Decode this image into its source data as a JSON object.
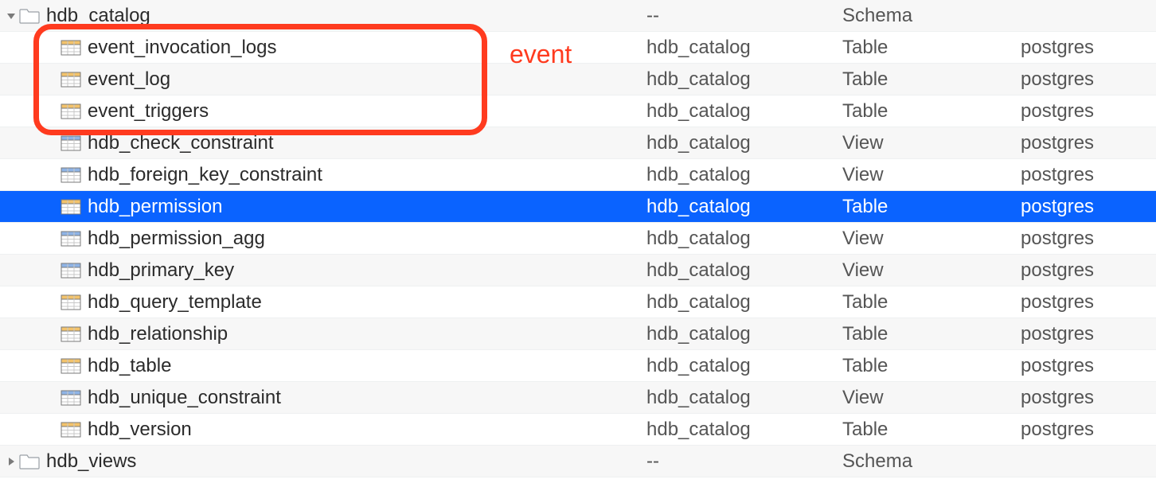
{
  "annotation": {
    "text": "event"
  },
  "rows": [
    {
      "expand": "open",
      "indent": 0,
      "icon": "folder",
      "name": "hdb_catalog",
      "schema": "--",
      "kind": "Schema",
      "owner": "",
      "selected": false,
      "alt": true
    },
    {
      "expand": "none",
      "indent": 1,
      "icon": "table",
      "name": "event_invocation_logs",
      "schema": "hdb_catalog",
      "kind": "Table",
      "owner": "postgres",
      "selected": false,
      "alt": false
    },
    {
      "expand": "none",
      "indent": 1,
      "icon": "table",
      "name": "event_log",
      "schema": "hdb_catalog",
      "kind": "Table",
      "owner": "postgres",
      "selected": false,
      "alt": true
    },
    {
      "expand": "none",
      "indent": 1,
      "icon": "table",
      "name": "event_triggers",
      "schema": "hdb_catalog",
      "kind": "Table",
      "owner": "postgres",
      "selected": false,
      "alt": false
    },
    {
      "expand": "none",
      "indent": 1,
      "icon": "view",
      "name": "hdb_check_constraint",
      "schema": "hdb_catalog",
      "kind": "View",
      "owner": "postgres",
      "selected": false,
      "alt": true
    },
    {
      "expand": "none",
      "indent": 1,
      "icon": "view",
      "name": "hdb_foreign_key_constraint",
      "schema": "hdb_catalog",
      "kind": "View",
      "owner": "postgres",
      "selected": false,
      "alt": false
    },
    {
      "expand": "none",
      "indent": 1,
      "icon": "table",
      "name": "hdb_permission",
      "schema": "hdb_catalog",
      "kind": "Table",
      "owner": "postgres",
      "selected": true,
      "alt": true
    },
    {
      "expand": "none",
      "indent": 1,
      "icon": "view",
      "name": "hdb_permission_agg",
      "schema": "hdb_catalog",
      "kind": "View",
      "owner": "postgres",
      "selected": false,
      "alt": false
    },
    {
      "expand": "none",
      "indent": 1,
      "icon": "view",
      "name": "hdb_primary_key",
      "schema": "hdb_catalog",
      "kind": "View",
      "owner": "postgres",
      "selected": false,
      "alt": true
    },
    {
      "expand": "none",
      "indent": 1,
      "icon": "table",
      "name": "hdb_query_template",
      "schema": "hdb_catalog",
      "kind": "Table",
      "owner": "postgres",
      "selected": false,
      "alt": false
    },
    {
      "expand": "none",
      "indent": 1,
      "icon": "table",
      "name": "hdb_relationship",
      "schema": "hdb_catalog",
      "kind": "Table",
      "owner": "postgres",
      "selected": false,
      "alt": true
    },
    {
      "expand": "none",
      "indent": 1,
      "icon": "table",
      "name": "hdb_table",
      "schema": "hdb_catalog",
      "kind": "Table",
      "owner": "postgres",
      "selected": false,
      "alt": false
    },
    {
      "expand": "none",
      "indent": 1,
      "icon": "view",
      "name": "hdb_unique_constraint",
      "schema": "hdb_catalog",
      "kind": "View",
      "owner": "postgres",
      "selected": false,
      "alt": true
    },
    {
      "expand": "none",
      "indent": 1,
      "icon": "table",
      "name": "hdb_version",
      "schema": "hdb_catalog",
      "kind": "Table",
      "owner": "postgres",
      "selected": false,
      "alt": false
    },
    {
      "expand": "closed",
      "indent": 0,
      "icon": "folder",
      "name": "hdb_views",
      "schema": "--",
      "kind": "Schema",
      "owner": "",
      "selected": false,
      "alt": true
    }
  ]
}
